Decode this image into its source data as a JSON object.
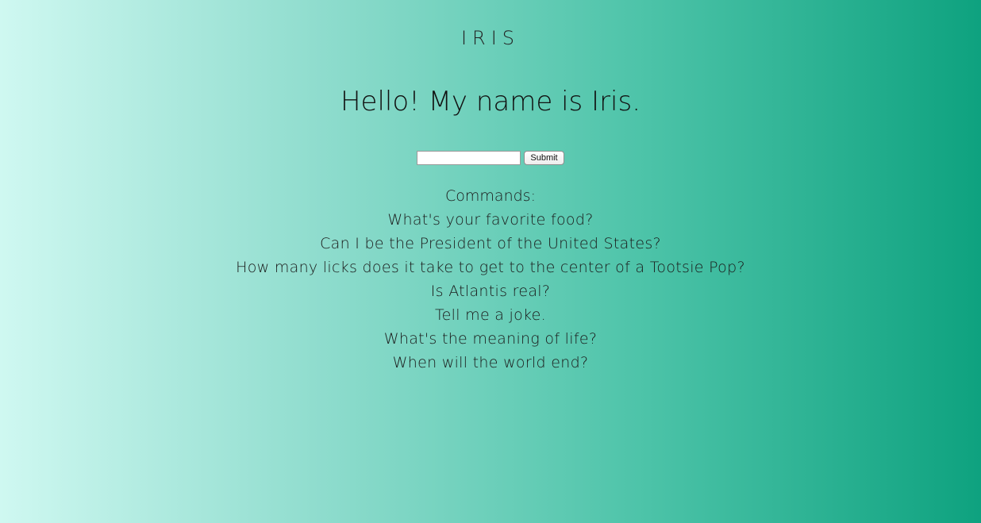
{
  "header": {
    "logo_text": "IRIS"
  },
  "main": {
    "greeting": "Hello! My name is Iris.",
    "form": {
      "input_value": "",
      "submit_label": "Submit"
    },
    "commands": {
      "title": "Commands:",
      "items": [
        "What's your favorite food?",
        "Can I be the President of the United States?",
        "How many licks does it take to get to the center of a Tootsie Pop?",
        "Is Atlantis real?",
        "Tell me a joke.",
        "What's the meaning of life?",
        "When will the world end?"
      ]
    }
  },
  "colors": {
    "gradient_left": "#cff8f1",
    "gradient_right": "#0ea27f"
  }
}
